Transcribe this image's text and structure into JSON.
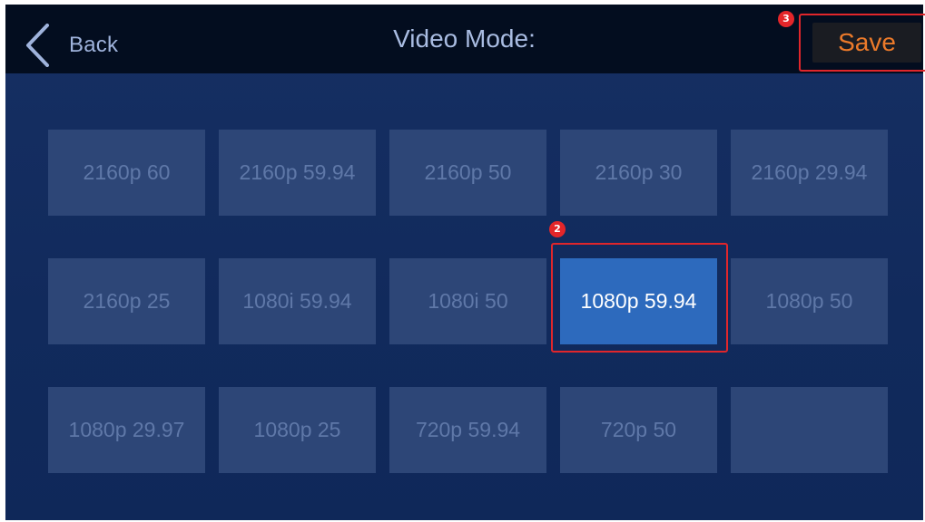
{
  "header": {
    "back_label": "Back",
    "title": "Video Mode:",
    "save_label": "Save"
  },
  "modes": [
    {
      "label": "2160p 60",
      "selected": false
    },
    {
      "label": "2160p 59.94",
      "selected": false
    },
    {
      "label": "2160p 50",
      "selected": false
    },
    {
      "label": "2160p 30",
      "selected": false
    },
    {
      "label": "2160p 29.94",
      "selected": false
    },
    {
      "label": "2160p 25",
      "selected": false
    },
    {
      "label": "1080i 59.94",
      "selected": false
    },
    {
      "label": "1080i 50",
      "selected": false
    },
    {
      "label": "1080p 59.94",
      "selected": true
    },
    {
      "label": "1080p 50",
      "selected": false
    },
    {
      "label": "1080p 29.97",
      "selected": false
    },
    {
      "label": "1080p 25",
      "selected": false
    },
    {
      "label": "720p 59.94",
      "selected": false
    },
    {
      "label": "720p 50",
      "selected": false
    },
    {
      "label": "",
      "selected": false
    }
  ],
  "annotations": {
    "step_selected_mode": "2",
    "step_save": "3"
  },
  "colors": {
    "accent_save": "#ec7a2a",
    "selected_tile": "#2d6abd",
    "highlight": "#e0262b"
  },
  "icons": {
    "back": "chevron-left-icon"
  }
}
